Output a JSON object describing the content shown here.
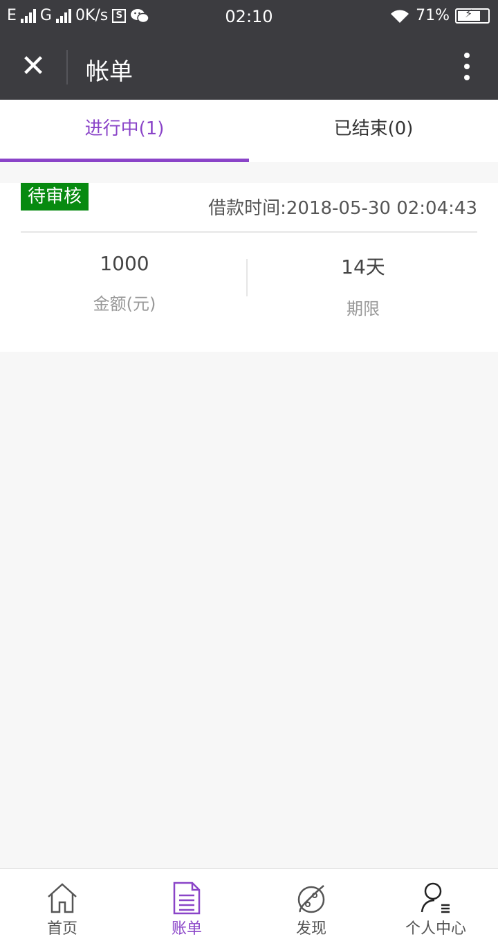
{
  "statusbar": {
    "net1": "E",
    "net2": "G",
    "speed": "0K/s",
    "s_icon_text": "S",
    "time": "02:10",
    "battery": "71%"
  },
  "titlebar": {
    "title": "帐单",
    "close_icon": "close-icon",
    "more_icon": "more-vertical-icon"
  },
  "tabs": [
    {
      "label": "进行中(1)",
      "active": true
    },
    {
      "label": "已结束(0)",
      "active": false
    }
  ],
  "bill": {
    "status": "待审核",
    "loan_time": "借款时间:2018-05-30 02:04:43",
    "amount_value": "1000",
    "amount_label": "金额(元)",
    "term_value": "14天",
    "term_label": "期限",
    "status_color": "#078a10"
  },
  "tabbar": [
    {
      "label": "首页",
      "icon": "home-icon"
    },
    {
      "label": "账单",
      "icon": "bill-icon",
      "active": true
    },
    {
      "label": "发现",
      "icon": "planet-icon"
    },
    {
      "label": "个人中心",
      "icon": "user-icon"
    }
  ],
  "colors": {
    "accent": "#8a44c8",
    "header_bg": "#3c3c40"
  }
}
